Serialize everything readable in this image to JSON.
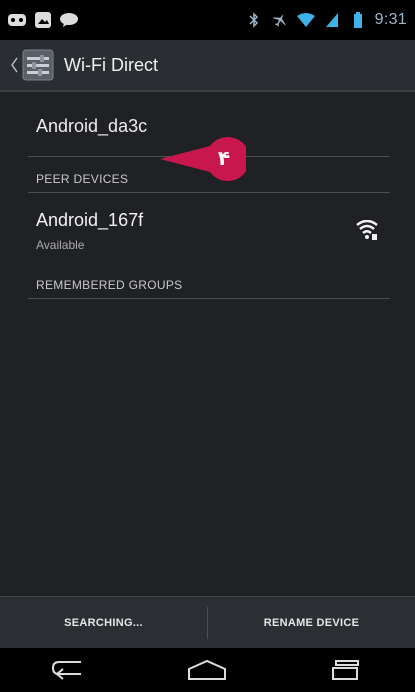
{
  "status_bar": {
    "time": "9:31",
    "left_icons": [
      "voicemail-icon",
      "gallery-notification-icon",
      "chat-notification-icon"
    ],
    "right_icons": [
      "bluetooth-icon",
      "airplane-icon",
      "wifi-signal-icon",
      "cell-signal-icon",
      "battery-icon"
    ]
  },
  "action_bar": {
    "title": "Wi-Fi Direct",
    "icon": "settings-app-icon"
  },
  "my_device": {
    "name": "Android_da3c"
  },
  "sections": {
    "peer_devices_header": "PEER DEVICES",
    "remembered_groups_header": "REMEMBERED GROUPS"
  },
  "peers": [
    {
      "name": "Android_167f",
      "status": "Available",
      "icon": "wifi-icon"
    }
  ],
  "annotation": {
    "label": "۴",
    "color": "#c8174d"
  },
  "buttons": {
    "searching": "SEARCHING...",
    "rename_device": "RENAME DEVICE"
  },
  "nav": [
    "back-icon",
    "home-icon",
    "recent-apps-icon"
  ],
  "colors": {
    "background": "#1f2124",
    "action_bar": "#2a2d31",
    "status_bar": "#000000",
    "clock": "#9fb6c8",
    "annotation": "#c8174d"
  }
}
